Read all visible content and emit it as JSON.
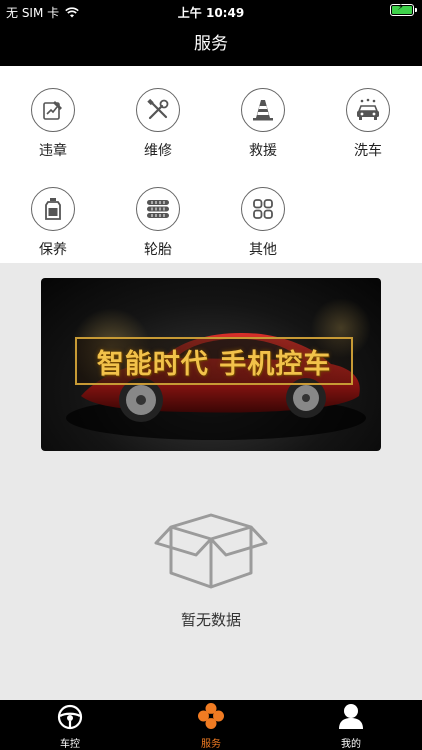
{
  "status_bar": {
    "carrier": "无 SIM 卡",
    "time": "上午 10:49"
  },
  "nav": {
    "title": "服务"
  },
  "services": [
    {
      "label": "违章",
      "icon": "violation-icon"
    },
    {
      "label": "维修",
      "icon": "repair-tools-icon"
    },
    {
      "label": "救援",
      "icon": "traffic-cone-icon"
    },
    {
      "label": "洗车",
      "icon": "car-wash-icon"
    },
    {
      "label": "保养",
      "icon": "oil-bottle-icon"
    },
    {
      "label": "轮胎",
      "icon": "tire-stack-icon"
    },
    {
      "label": "其他",
      "icon": "grid-icon"
    }
  ],
  "banner": {
    "slogan": "智能时代 手机控车"
  },
  "empty_state": {
    "label": "暂无数据",
    "icon": "empty-box-icon"
  },
  "tab_bar": {
    "tabs": [
      {
        "label": "车控",
        "icon": "steering-wheel-icon"
      },
      {
        "label": "服务",
        "icon": "service-flower-icon",
        "active": true
      },
      {
        "label": "我的",
        "icon": "person-icon"
      }
    ]
  },
  "colors": {
    "accent": "#f07b22",
    "bar_bg": "#000000",
    "page_bg": "#e9e9e9",
    "battery": "#3ed04a",
    "slogan": "#f2c24a"
  }
}
